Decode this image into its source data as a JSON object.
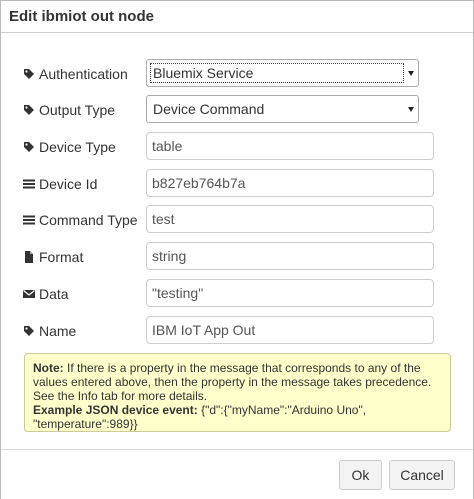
{
  "dialog": {
    "title": "Edit ibmiot out node"
  },
  "fields": {
    "authentication": {
      "label": "Authentication",
      "value": "Bluemix Service",
      "icon": "tag-icon"
    },
    "output_type": {
      "label": "Output Type",
      "value": "Device Command",
      "icon": "tag-icon"
    },
    "device_type": {
      "label": "Device Type",
      "value": "table",
      "icon": "tag-icon"
    },
    "device_id": {
      "label": "Device Id",
      "value": "b827eb764b7a",
      "icon": "list-icon"
    },
    "command_type": {
      "label": "Command Type",
      "value": "test",
      "icon": "list-icon"
    },
    "format": {
      "label": "Format",
      "value": "string",
      "icon": "file-icon"
    },
    "data": {
      "label": "Data",
      "value": "\"testing\"",
      "icon": "envelope-icon"
    },
    "name": {
      "label": "Name",
      "value": "IBM IoT App Out",
      "icon": "tag-icon"
    }
  },
  "note": {
    "note_label": "Note:",
    "note_text": " If there is a property in the message that corresponds to any of the values entered above, then the property in the message takes precedence. See the Info tab for more details.",
    "example_label": "Example JSON device event:",
    "example_text": " {\"d\":{\"myName\":\"Arduino Uno\", \"temperature\":989}}",
    "background": "#ffffcc"
  },
  "buttons": {
    "ok": "Ok",
    "cancel": "Cancel"
  }
}
